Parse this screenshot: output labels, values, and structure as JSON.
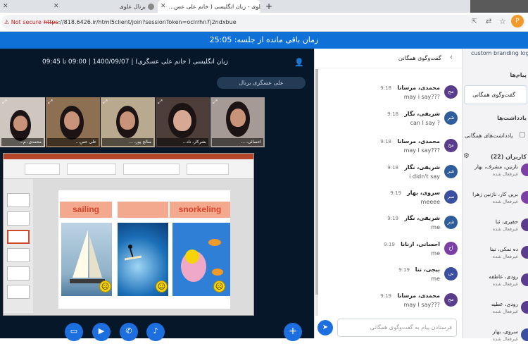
{
  "browser": {
    "tabs": [
      {
        "label": "برنال علوی",
        "fav": "#888"
      },
      {
        "label": "علوی - زبان انگلیسی ( خانم علی عس...",
        "fav": "#d33"
      }
    ],
    "not_secure": "Not secure",
    "url_scheme": "https",
    "url_rest": "://818.6426.ir/html5client/join?sessionToken=oclrrhn7j2ndxbue",
    "profile_initial": "P"
  },
  "session": {
    "timer_text": "زمان باقی مانده از جلسه: 25:05",
    "meeting_title": "زبان انگلیسی ( خانم علی عسگری) | 1400/09/07 | 09:00 تا 09:45",
    "presenter": "علی عسگری برنال"
  },
  "webcams": [
    {
      "name": "احصائی، ..."
    },
    {
      "name": "بشرکار، ناد..."
    },
    {
      "name": "صالح پور، ..."
    },
    {
      "name": "علی عس..."
    },
    {
      "name": "محمدی، م..."
    }
  ],
  "slide": {
    "words": [
      "sailing",
      "",
      "snorkeling"
    ]
  },
  "chat": {
    "title": "گفت‌وگوی همگانی",
    "input_placeholder": "فرستادن پیام به گفت‌وگوی همگانی",
    "messages": [
      {
        "avatar": "مح",
        "color": "#5a3c8c",
        "name": "محمدی، مرسانا",
        "time": "9:18",
        "text": "may i say???"
      },
      {
        "avatar": "شر",
        "color": "#2e5d9c",
        "name": "شریفی، نگار",
        "time": "9:18",
        "text": "can I say ?"
      },
      {
        "avatar": "مح",
        "color": "#5a3c8c",
        "name": "محمدی، مرسانا",
        "time": "9:18",
        "text": "may I say???"
      },
      {
        "avatar": "شر",
        "color": "#2e5d9c",
        "name": "شریفی، نگار",
        "time": "9:18",
        "text": "i didn't say"
      },
      {
        "avatar": "سر",
        "color": "#3b4fa0",
        "name": "سروی، بهار",
        "time": "9:19",
        "text": "meeee"
      },
      {
        "avatar": "شر",
        "color": "#2e5d9c",
        "name": "شریفی، نگار",
        "time": "9:19",
        "text": "me"
      },
      {
        "avatar": "اح",
        "color": "#7b3fa6",
        "name": "احسانی، ارنانا",
        "time": "9:19",
        "text": "me"
      },
      {
        "avatar": "بی",
        "color": "#3b4fa0",
        "name": "بیجی، تنا",
        "time": "9:19",
        "text": "me"
      },
      {
        "avatar": "مح",
        "color": "#5a3c8c",
        "name": "محمدی، مرسانا",
        "time": "9:19",
        "text": "may I say???"
      }
    ]
  },
  "userlist": {
    "branding": "custom branding logo",
    "messages_heading": "پیام‌ها",
    "public_chat": "گفت‌وگوی همگانی",
    "notes_heading": "یادداشت‌ها",
    "shared_notes": "یادداشت‌های همگانی",
    "users_heading": "کاربران (22)",
    "users": [
      {
        "name": "نازنین، مشرف، بهار",
        "status": "غیرفعال شده",
        "color": "#7b3fa6"
      },
      {
        "name": "برین کار، نازنین زهرا",
        "status": "غیرفعال شده",
        "color": "#7b3fa6"
      },
      {
        "name": "حقیری، ثنا",
        "status": "غیرفعال شده",
        "color": "#5a3c8c"
      },
      {
        "name": "ده نمکی، نینا",
        "status": "غیرفعال شده",
        "color": "#5a3c8c"
      },
      {
        "name": "رودی، عاطفه",
        "status": "غیرفعال شده",
        "color": "#5a3c8c"
      },
      {
        "name": "رودی، عطیه",
        "status": "غیرفعال شده",
        "color": "#5a3c8c"
      },
      {
        "name": "سروی، بهار",
        "status": "غیرفعال شده",
        "color": "#3b4fa0"
      }
    ]
  }
}
